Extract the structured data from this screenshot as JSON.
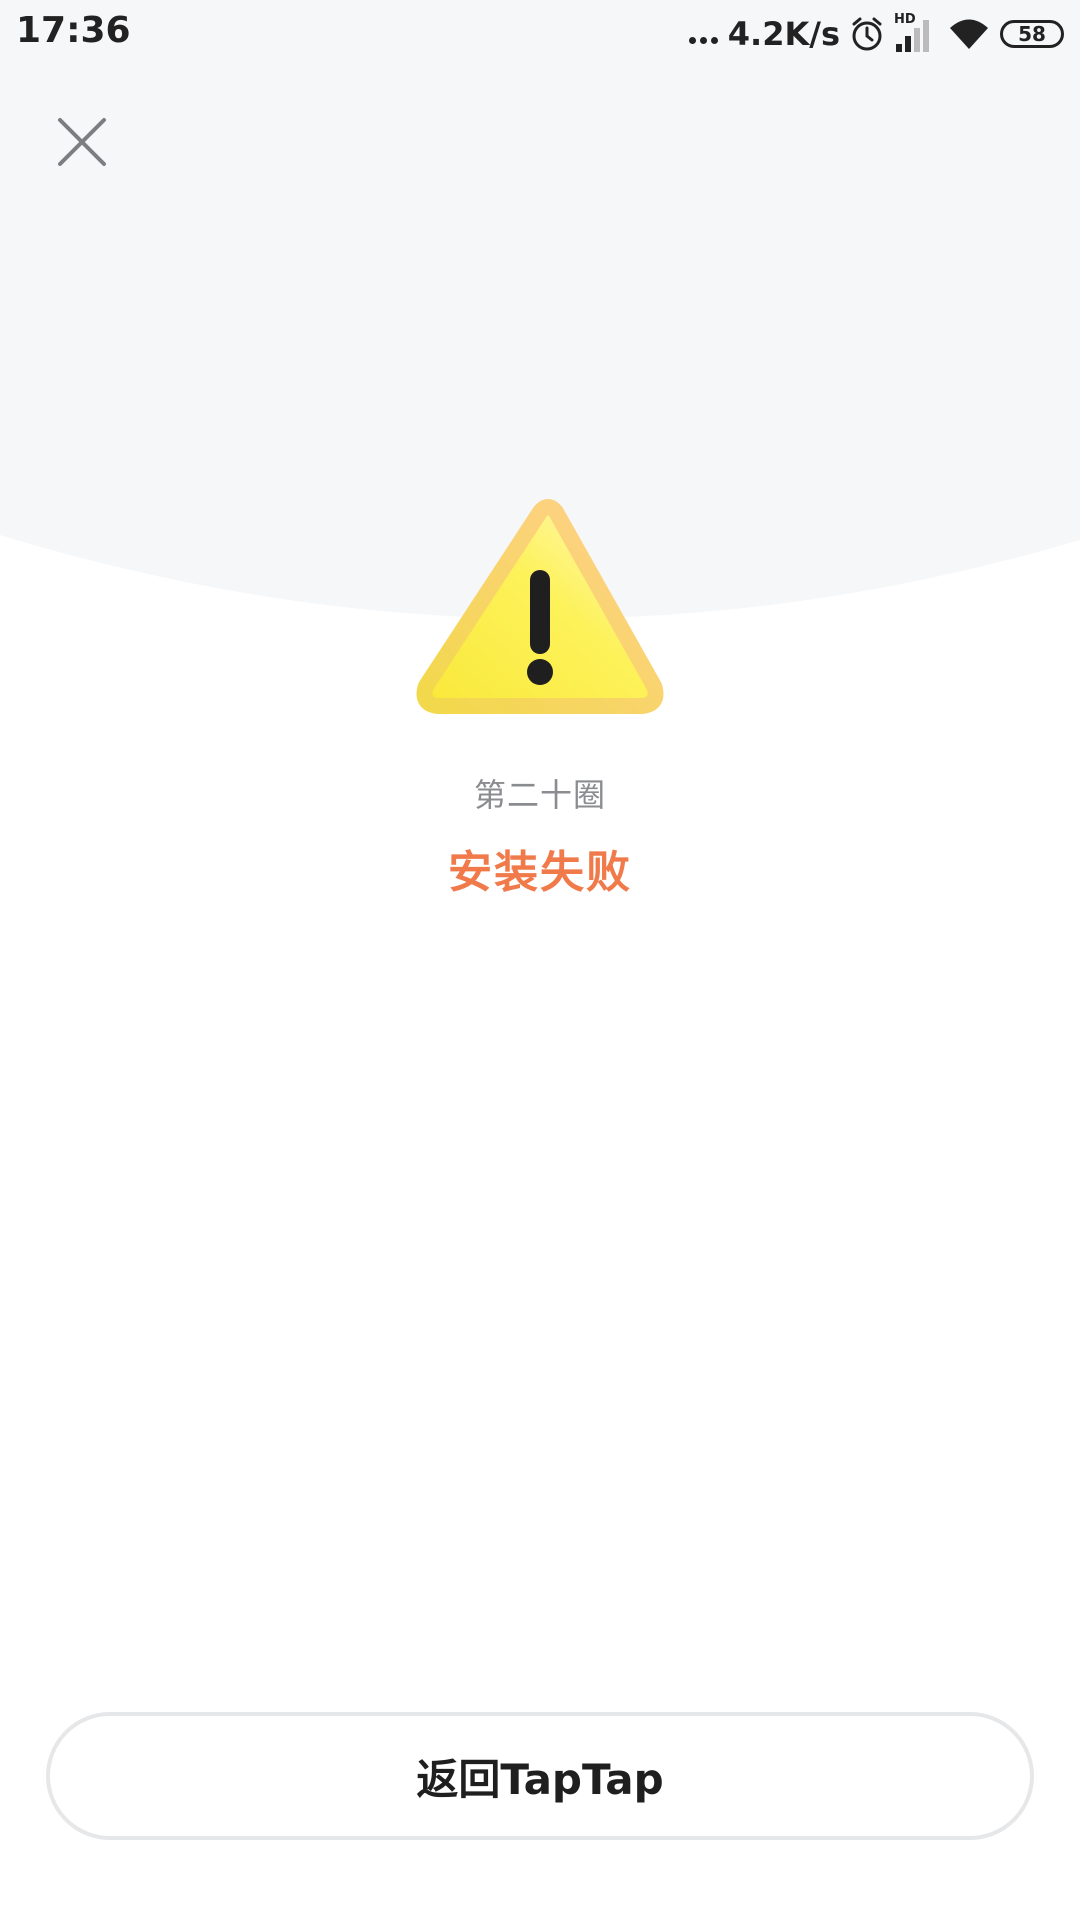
{
  "status_bar": {
    "time": "17:36",
    "network_speed": "4.2K/s",
    "hd_label": "HD",
    "battery_level": "58",
    "icons": [
      "more-dots-icon",
      "alarm-icon",
      "cellular-signal-icon",
      "wifi-icon",
      "battery-icon"
    ]
  },
  "header": {
    "close_icon": "close-icon"
  },
  "result": {
    "icon": "warning-icon",
    "game_name": "第二十圈",
    "status_text": "安装失败"
  },
  "footer": {
    "return_button_label": "返回TapTap"
  },
  "colors": {
    "top_background": "#f6f7f9",
    "status_text": "#f07a4a",
    "subtitle_text": "#8a8c90",
    "warning_fill": "#fdec3a",
    "warning_border": "#ffd38c",
    "button_border": "#e6e7e9"
  }
}
